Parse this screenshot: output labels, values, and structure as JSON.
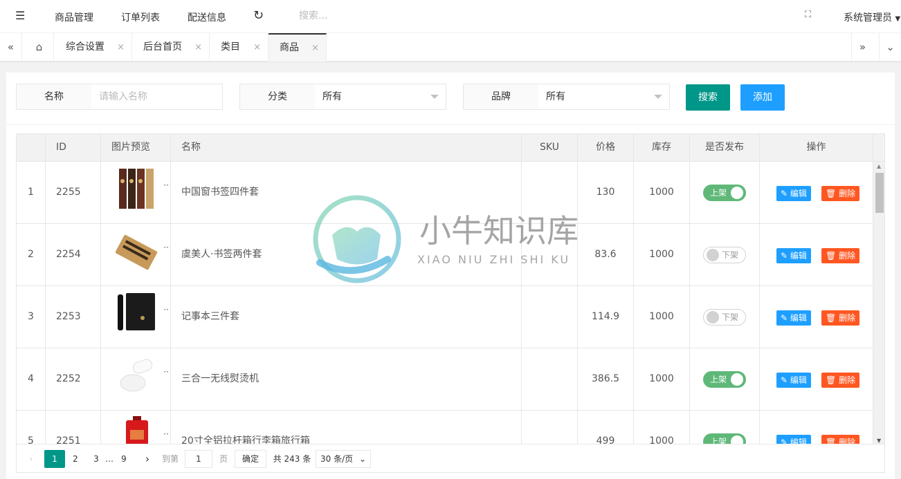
{
  "header": {
    "nav": [
      "商品管理",
      "订单列表",
      "配送信息"
    ],
    "search_placeholder": "搜索...",
    "user": "系统管理员"
  },
  "tabs": [
    "综合设置",
    "后台首页",
    "类目",
    "商品"
  ],
  "filters": {
    "name_label": "名称",
    "name_placeholder": "请输入名称",
    "category_label": "分类",
    "category_value": "所有",
    "brand_label": "品牌",
    "brand_value": "所有",
    "search_btn": "搜索",
    "add_btn": "添加"
  },
  "table": {
    "columns": [
      "ID",
      "图片预览",
      "名称",
      "SKU",
      "价格",
      "库存",
      "是否发布",
      "操作"
    ],
    "rows": [
      {
        "index": "1",
        "id": "2255",
        "name": "中国窗书签四件套",
        "sku": "",
        "price": "130",
        "stock": "1000",
        "published": true
      },
      {
        "index": "2",
        "id": "2254",
        "name": "虞美人·书签两件套",
        "sku": "",
        "price": "83.6",
        "stock": "1000",
        "published": false
      },
      {
        "index": "3",
        "id": "2253",
        "name": "记事本三件套",
        "sku": "",
        "price": "114.9",
        "stock": "1000",
        "published": false
      },
      {
        "index": "4",
        "id": "2252",
        "name": "三合一无线熨烫机",
        "sku": "",
        "price": "386.5",
        "stock": "1000",
        "published": true
      },
      {
        "index": "5",
        "id": "2251",
        "name": "20寸全铝拉杆箱行李箱旅行箱",
        "sku": "",
        "price": "499",
        "stock": "1000",
        "published": true
      }
    ],
    "switch_on": "上架",
    "switch_off": "下架",
    "edit_label": "编辑",
    "delete_label": "删除",
    "thumb_dots": "··"
  },
  "pagination": {
    "pages": [
      "1",
      "2",
      "3",
      "…",
      "9"
    ],
    "goto_label": "到第",
    "goto_value": "1",
    "page_unit": "页",
    "confirm": "确定",
    "total": "共 243 条",
    "page_size": "30 条/页"
  },
  "watermark": {
    "title": "小牛知识库",
    "subtitle": "XIAO NIU ZHI SHI KU"
  },
  "colors": {
    "primary": "#009688",
    "blue": "#1e9fff",
    "danger": "#ff5722",
    "switch_on": "#5fb878"
  }
}
